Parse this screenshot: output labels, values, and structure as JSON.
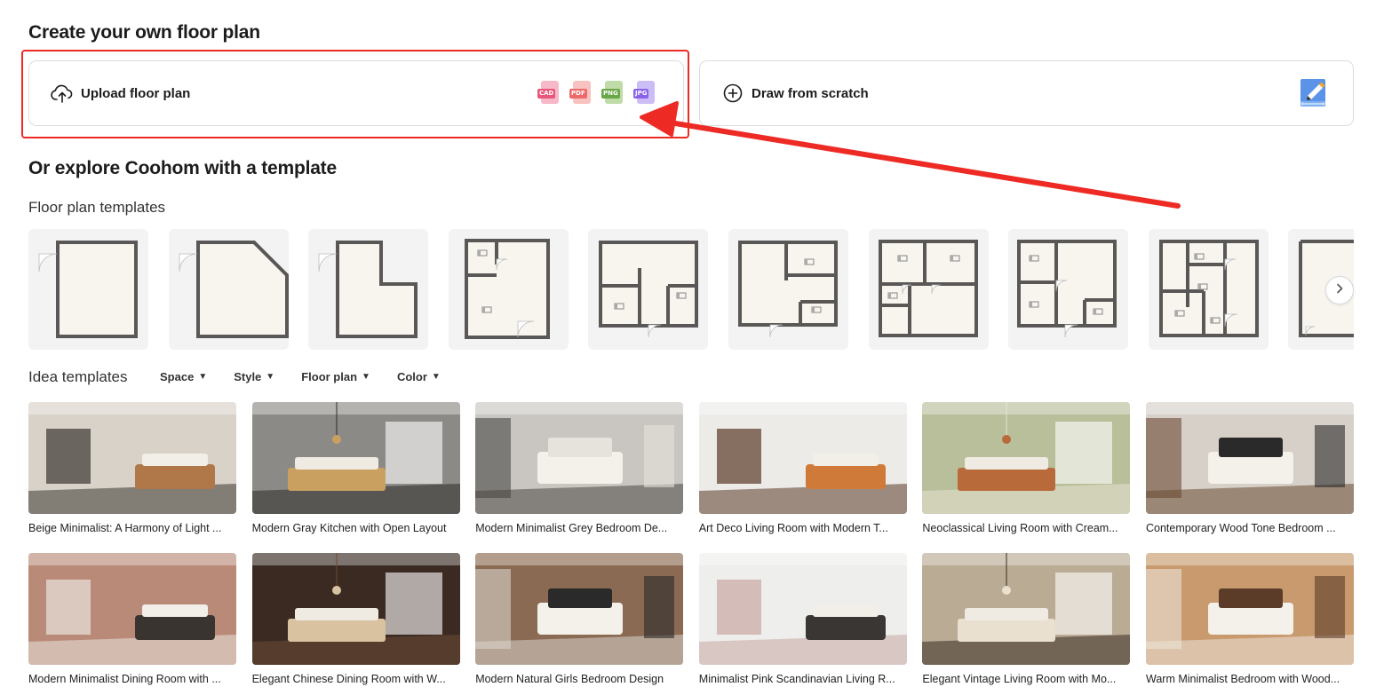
{
  "headings": {
    "create": "Create your own floor plan",
    "explore": "Or explore Coohom with a template",
    "floor_plan_templates": "Floor plan templates",
    "idea_templates": "Idea templates"
  },
  "upload_card": {
    "label": "Upload floor plan",
    "icon": "cloud-upload-icon",
    "file_types": [
      {
        "label": "CAD",
        "color": "#e8577a",
        "doc": "#f7b9c8"
      },
      {
        "label": "PDF",
        "color": "#ec6a6a",
        "doc": "#f8c2c0"
      },
      {
        "label": "PNG",
        "color": "#6aa847",
        "doc": "#bfdca8"
      },
      {
        "label": "JPG",
        "color": "#8a63e8",
        "doc": "#cdbdf6"
      }
    ]
  },
  "draw_card": {
    "label": "Draw from scratch",
    "icon": "plus-circle-icon"
  },
  "filters": [
    {
      "label": "Space"
    },
    {
      "label": "Style"
    },
    {
      "label": "Floor plan"
    },
    {
      "label": "Color"
    }
  ],
  "idea_templates": [
    {
      "caption": "Beige Minimalist: A Harmony of Light ...",
      "palette": [
        "#d9d2c8",
        "#3b3631",
        "#b07848"
      ]
    },
    {
      "caption": "Modern Gray Kitchen with Open Layout",
      "palette": [
        "#8c8a86",
        "#2e2c2a",
        "#c9a060"
      ]
    },
    {
      "caption": "Modern Minimalist Grey Bedroom De...",
      "palette": [
        "#c9c6c1",
        "#4a4744",
        "#e6e2dc"
      ]
    },
    {
      "caption": "Art Deco Living Room with Modern T...",
      "palette": [
        "#ecebe8",
        "#5b3b28",
        "#d07a3a"
      ]
    },
    {
      "caption": "Neoclassical Living Room with Cream...",
      "palette": [
        "#b8bf9a",
        "#e8e2d4",
        "#b86a3a"
      ]
    },
    {
      "caption": "Contemporary Wood Tone Bedroom ...",
      "palette": [
        "#d6d0c8",
        "#6a4a32",
        "#2a2a2a"
      ]
    },
    {
      "caption": "Modern Minimalist Dining Room with ...",
      "palette": [
        "#b98a78",
        "#e9e4de",
        "#3a3430"
      ]
    },
    {
      "caption": "Elegant Chinese Dining Room with W...",
      "palette": [
        "#3a2a22",
        "#6b4a34",
        "#d8c2a0"
      ]
    },
    {
      "caption": "Modern Natural Girls Bedroom Design",
      "palette": [
        "#8a6a52",
        "#d9d4cc",
        "#2a2a2a"
      ]
    },
    {
      "caption": "Minimalist Pink Scandinavian Living R...",
      "palette": [
        "#eeeeec",
        "#c9a7a4",
        "#3a3634"
      ]
    },
    {
      "caption": "Elegant Vintage Living Room with Mo...",
      "palette": [
        "#b9ab94",
        "#3b2c22",
        "#e9e0d0"
      ]
    },
    {
      "caption": "Warm Minimalist Bedroom with Wood...",
      "palette": [
        "#c89a6e",
        "#ece4d8",
        "#5a3c28"
      ]
    }
  ]
}
